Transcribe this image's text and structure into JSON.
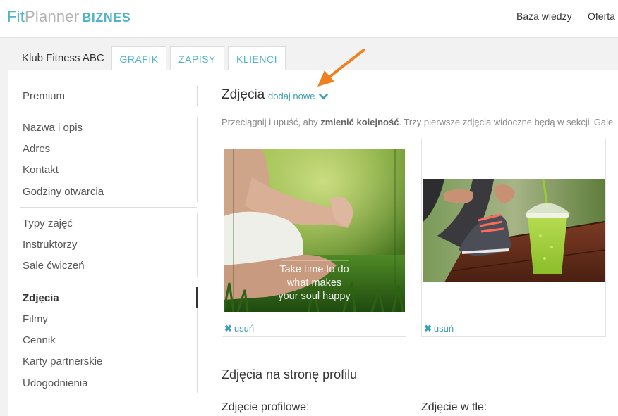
{
  "brand": {
    "fit": "Fit",
    "planner": "Planner",
    "biznes": "BIZNES"
  },
  "topnav": {
    "knowledge": "Baza wiedzy",
    "offer": "Oferta"
  },
  "club": {
    "name": "Klub Fitness ABC"
  },
  "tabs": [
    {
      "label": "GRAFIK"
    },
    {
      "label": "ZAPISY"
    },
    {
      "label": "KLIENCI"
    }
  ],
  "sidebar": {
    "groups": [
      [
        {
          "label": "Premium"
        }
      ],
      [
        {
          "label": "Nazwa i opis"
        },
        {
          "label": "Adres"
        },
        {
          "label": "Kontakt"
        },
        {
          "label": "Godziny otwarcia"
        }
      ],
      [
        {
          "label": "Typy zajęć"
        },
        {
          "label": "Instruktorzy"
        },
        {
          "label": "Sale ćwiczeń"
        }
      ],
      [
        {
          "label": "Zdjęcia",
          "active": true
        },
        {
          "label": "Filmy"
        },
        {
          "label": "Cennik"
        },
        {
          "label": "Karty partnerskie"
        },
        {
          "label": "Udogodnienia"
        }
      ]
    ]
  },
  "photos_section": {
    "title": "Zdjęcia",
    "add_new": "dodaj nowe",
    "hint_pre": "Przeciągnij i upuść, aby ",
    "hint_bold": "zmienić kolejność",
    "hint_post": ". Trzy pierwsze zdjęcia widoczne będą w sekcji 'Gale",
    "photos": [
      {
        "caption_line1": "Take time to do",
        "caption_line2": "what makes",
        "caption_line3": "your soul happy",
        "remove": "usuń"
      },
      {
        "remove": "usuń"
      }
    ]
  },
  "profile_section": {
    "title": "Zdjęcia na stronę profilu",
    "profile_photo": "Zdjęcie profilowe:",
    "background_photo": "Zdjęcie w tle:"
  },
  "colors": {
    "accent": "#52b5c7",
    "link": "#3a9fb2",
    "annotation_arrow": "#f07f1e"
  },
  "icons": {
    "add_new": "chevron-down-icon",
    "remove": "close-icon",
    "annotation": "arrow-annotation"
  }
}
